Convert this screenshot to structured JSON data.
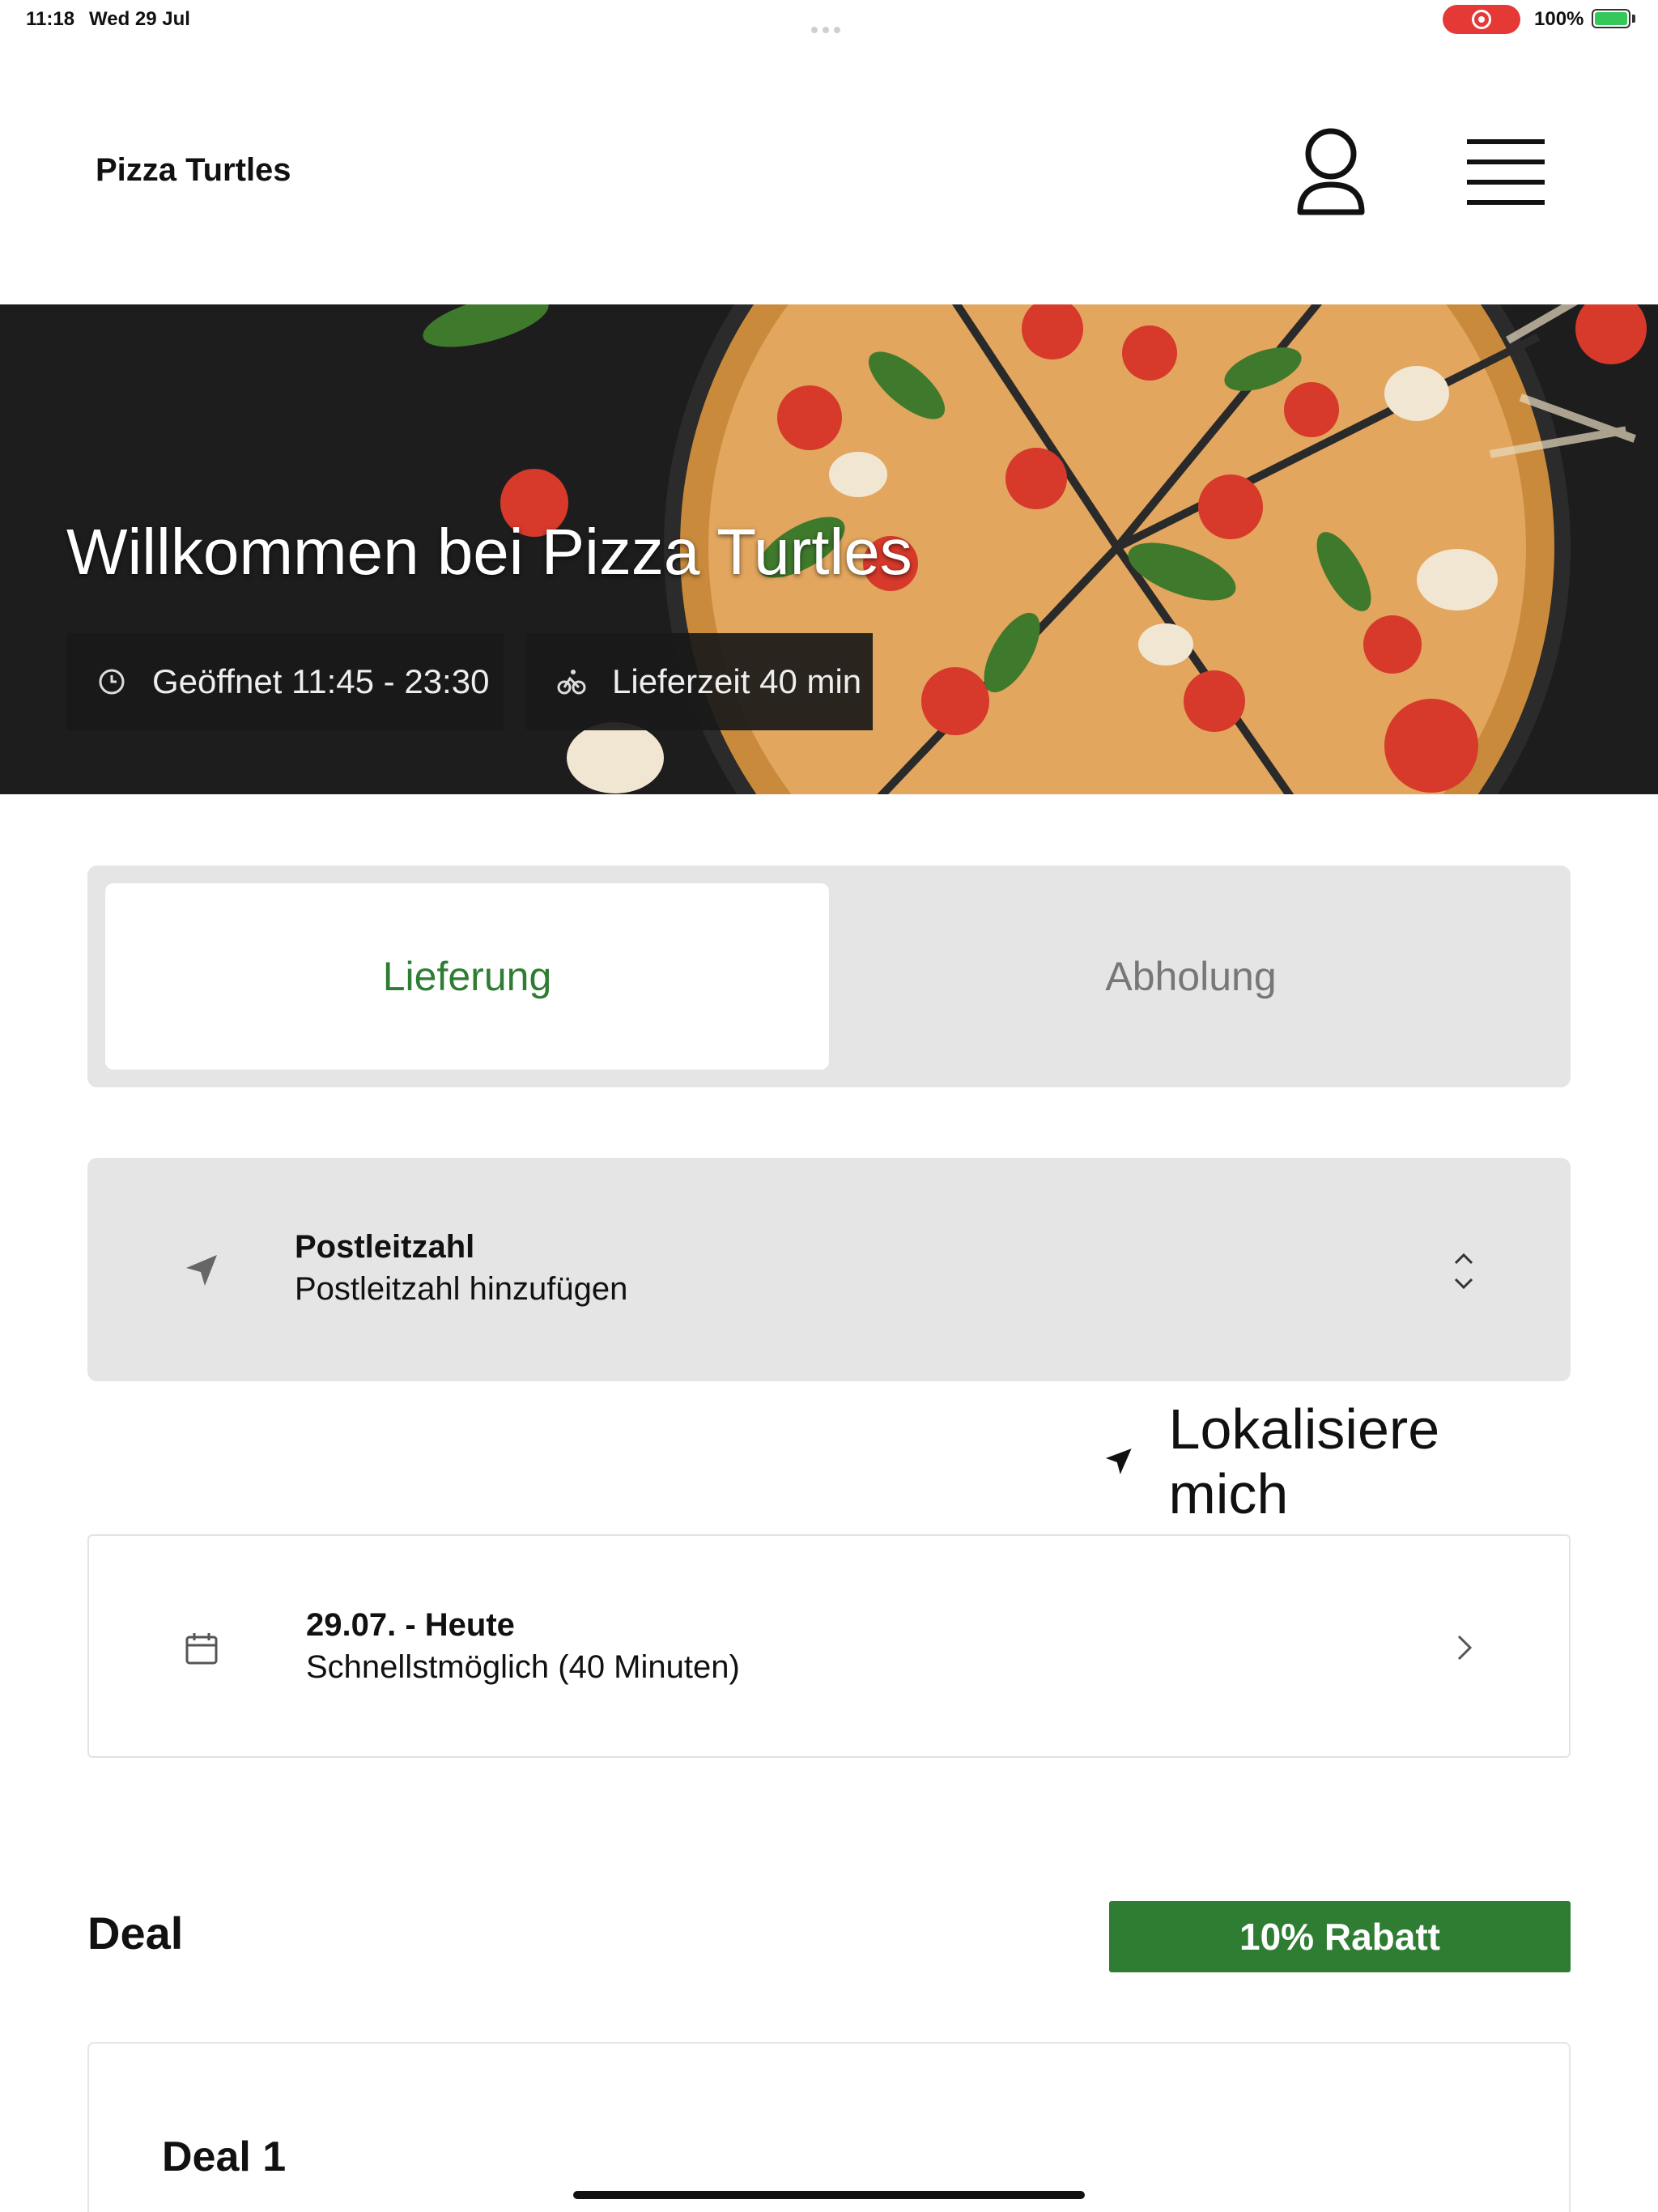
{
  "status_bar": {
    "time": "11:18",
    "date": "Wed 29 Jul",
    "battery": "100%"
  },
  "header": {
    "brand": "Pizza Turtles",
    "account_icon": "user-icon",
    "menu_icon": "hamburger-menu-icon"
  },
  "hero": {
    "title": "Willkommen bei Pizza Turtles",
    "opening_hours": "Geöffnet 11:45 - 23:30",
    "delivery_time": "Lieferzeit 40 min",
    "opening_icon": "clock-icon",
    "delivery_icon": "bicycle-icon"
  },
  "order_mode": {
    "options": [
      "Lieferung",
      "Abholung"
    ],
    "selected": "Lieferung"
  },
  "postcode": {
    "label": "Postleitzahl",
    "placeholder": "Postleitzahl hinzufügen",
    "icon": "location-arrow-icon"
  },
  "locate": {
    "label": "Lokalisiere mich",
    "icon": "location-arrow-icon"
  },
  "schedule": {
    "date_label": "29.07. - Heute",
    "time_label": "Schnellstmöglich (40 Minuten)",
    "icon": "calendar-icon"
  },
  "deal": {
    "heading": "Deal",
    "badge": "10% Rabatt",
    "cards": [
      {
        "title": "Deal 1"
      }
    ]
  },
  "colors": {
    "accent_green": "#2e7d32",
    "panel_gray": "#e5e5e5",
    "text_dark": "#111111"
  }
}
